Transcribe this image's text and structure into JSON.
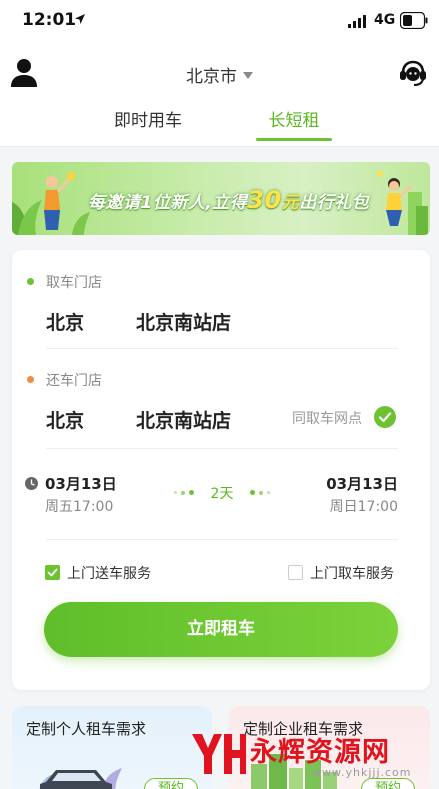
{
  "status_bar": {
    "time": "12:01",
    "network": "4G"
  },
  "header": {
    "city": "北京市"
  },
  "tabs": [
    {
      "label": "即时用车",
      "active": false
    },
    {
      "label": "长短租",
      "active": true
    }
  ],
  "banner": {
    "text_before": "每邀请1位新人,立得",
    "amount": "30",
    "unit": "元",
    "text_after": "出行礼包"
  },
  "rental": {
    "pickup": {
      "label": "取车门店",
      "city": "北京",
      "store": "北京南站店"
    },
    "return": {
      "label": "还车门店",
      "city": "北京",
      "store": "北京南站店",
      "same_label": "同取车网点"
    },
    "start": {
      "date": "03月13日",
      "weekday_time": "周五17:00"
    },
    "duration": "2天",
    "end": {
      "date": "03月13日",
      "weekday_time": "周日17:00"
    },
    "options": [
      {
        "label": "上门送车服务",
        "checked": true
      },
      {
        "label": "上门取车服务",
        "checked": false
      }
    ],
    "submit_label": "立即租车"
  },
  "promo_cards": [
    {
      "title": "定制个人租车需求",
      "tag": "预约"
    },
    {
      "title": "定制企业租车需求",
      "tag": "预约"
    }
  ],
  "watermark": {
    "text": "永辉资源网",
    "url": "www.yhkjjj.com"
  },
  "colors": {
    "accent": "#6cc230",
    "accent_text": "#5bb821",
    "return_dot": "#f28b3c",
    "watermark": "#e0141e"
  }
}
